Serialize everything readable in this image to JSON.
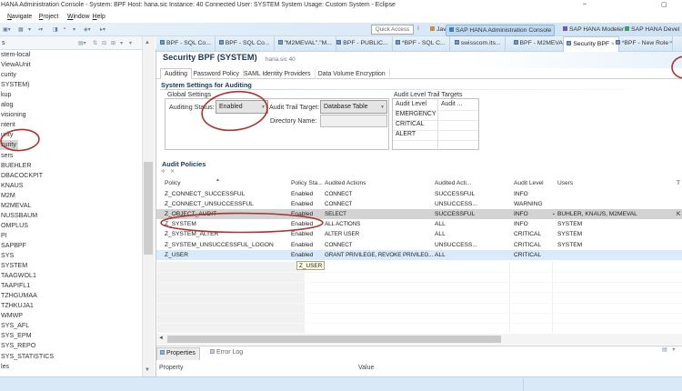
{
  "title_bar": {
    "title": "HANA Administration Console - System: BPF Host: hana.sic Instance: 40 Connected User: SYSTEM System Usage: Custom System - Eclipse",
    "minimize": "–",
    "maximize": "▢"
  },
  "menu": {
    "items": [
      "Navigate",
      "Project",
      "Window",
      "Help"
    ]
  },
  "toolbar": {
    "quick_access_label": "Quick Access"
  },
  "perspectives": {
    "tabs": [
      {
        "label": "Java",
        "active": false
      },
      {
        "label": "SAP HANA Administration Console",
        "active": true
      },
      {
        "label": "SAP HANA Modeler",
        "active": false
      },
      {
        "label": "SAP HANA Devel",
        "active": false
      }
    ]
  },
  "editor_tabs": [
    {
      "label": "BPF - SQL Co...",
      "active": false
    },
    {
      "label": "BPF - SQL Co...",
      "active": false
    },
    {
      "label": "\"M2MEVAL\".\"M...",
      "active": false
    },
    {
      "label": "BPF - PUBLIC...",
      "active": false
    },
    {
      "label": "*BPF - SQL C...",
      "active": false
    },
    {
      "label": "swisscom.its...",
      "active": false
    },
    {
      "label": "BPF - M2MEVAL",
      "active": false
    },
    {
      "label": "Security BPF",
      "active": true
    },
    {
      "label": "*BPF - New Role",
      "active": false
    }
  ],
  "sidebar": {
    "header": "s",
    "items": [
      {
        "label": "stem-local"
      },
      {
        "label": "ViewAUnit"
      },
      {
        "label": "curity"
      },
      {
        "label": "SYSTEM)"
      },
      {
        "label": "kup"
      },
      {
        "label": "alog"
      },
      {
        "label": "visioning"
      },
      {
        "label": "ntent"
      },
      {
        "label": "urity"
      },
      {
        "label": "curity",
        "selected": true
      },
      {
        "label": "sers"
      },
      {
        "label": "BUEHLER"
      },
      {
        "label": "DBACOCKPIT"
      },
      {
        "label": "KNAUS"
      },
      {
        "label": "M2M"
      },
      {
        "label": "M2MEVAL"
      },
      {
        "label": "NUSSBAUM"
      },
      {
        "label": "OMPLUS"
      },
      {
        "label": "PI"
      },
      {
        "label": "SAPBPF"
      },
      {
        "label": "SYS"
      },
      {
        "label": "SYSTEM"
      },
      {
        "label": "TAAGWOL1"
      },
      {
        "label": "TAAPIFL1"
      },
      {
        "label": "TZHGUMAA"
      },
      {
        "label": "TZHKUJA1"
      },
      {
        "label": "WMWP"
      },
      {
        "label": "SYS_AFL"
      },
      {
        "label": "SYS_EPM"
      },
      {
        "label": "SYS_REPO"
      },
      {
        "label": "SYS_STATISTICS"
      },
      {
        "label": "les"
      }
    ]
  },
  "form": {
    "title": "Security BPF (SYSTEM)",
    "subtitle": "hana.sic 40",
    "tabs": [
      {
        "label": "Auditing",
        "active": true
      },
      {
        "label": "Password Policy",
        "active": false
      },
      {
        "label": "SAML Identity Providers",
        "active": false
      },
      {
        "label": "Data Volume Encryption",
        "active": false
      }
    ],
    "section_title": "System Settings for Auditing",
    "global_settings": {
      "label": "Global Settings",
      "auditing_status_label": "Auditing Status:",
      "auditing_status_value": "Enabled",
      "audit_trail_target_label": "Audit Trail Target:",
      "audit_trail_target_value": "Database Table",
      "directory_name_label": "Directory Name:",
      "directory_name_value": ""
    },
    "audit_level_trail": {
      "title": "Audit Level Trail Targets",
      "columns": [
        "Audit Level",
        "Audit ..."
      ],
      "rows": [
        "EMERGENCY",
        "CRITICAL",
        "ALERT"
      ]
    }
  },
  "audit_policies": {
    "title": "Audit Policies",
    "columns": [
      "Policy",
      "Policy Sta...",
      "Audited Actions",
      "Audited Acti...",
      "Audit Level",
      "Users",
      "T"
    ],
    "rows": [
      {
        "policy": "Z_CONNECT_SUCCESSFUL",
        "status": "Enabled",
        "actions": "CONNECT",
        "audited_action": "SUCCESSFUL",
        "level": "INFO",
        "users": "",
        "extra": "",
        "highlight": ""
      },
      {
        "policy": "Z_CONNECT_UNSUCCESSFUL",
        "status": "Enabled",
        "actions": "CONNECT",
        "audited_action": "UNSUCCESS...",
        "level": "WARNING",
        "users": "",
        "extra": "",
        "highlight": ""
      },
      {
        "policy": "Z_OBJECT_AUDIT",
        "status": "Enabled",
        "actions": "SELECT",
        "audited_action": "SUCCESSFUL",
        "level": "INFO",
        "users": "BUHLER, KNAUS, M2MEVAL",
        "extra": "K",
        "highlight": "gray"
      },
      {
        "policy": "Z_SYSTEM",
        "status": "Enabled",
        "actions": "ALL ACTIONS",
        "audited_action": "ALL",
        "level": "INFO",
        "users": "SYSTEM",
        "extra": "",
        "highlight": ""
      },
      {
        "policy": "Z_SYSTEM_ALTER",
        "status": "Enabled",
        "actions": "ALTER USER",
        "audited_action": "ALL",
        "level": "CRITICAL",
        "users": "SYSTEM",
        "extra": "",
        "highlight": ""
      },
      {
        "policy": "Z_SYSTEM_UNSUCCESSFUL_LOGON",
        "status": "Enabled",
        "actions": "CONNECT",
        "audited_action": "UNSUCCESS...",
        "level": "CRITICAL",
        "users": "SYSTEM",
        "extra": "",
        "highlight": ""
      },
      {
        "policy": "Z_USER",
        "status": "Enabled",
        "actions": "GRANT PRIVILEGE, REVOKE PRIVILEG...",
        "audited_action": "ALL",
        "level": "CRITICAL",
        "users": "",
        "extra": "",
        "highlight": "blue"
      }
    ],
    "tooltip": "Z_USER"
  },
  "properties": {
    "tabs": [
      {
        "label": "Properties",
        "active": true
      },
      {
        "label": "Error Log",
        "active": false
      }
    ],
    "columns": [
      "Property",
      "Value"
    ]
  },
  "annotations": {
    "color": "#a93430"
  }
}
